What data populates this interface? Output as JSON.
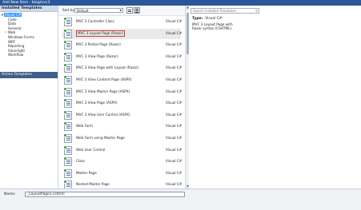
{
  "window": {
    "title": "Add New Item - blogmvc3"
  },
  "left_pane": {
    "installed_header": "Installed Templates",
    "tree": [
      {
        "label": "Visual C#",
        "level": 0,
        "expanded": true,
        "selected": true
      },
      {
        "label": "Code",
        "level": 1
      },
      {
        "label": "Data",
        "level": 1
      },
      {
        "label": "General",
        "level": 1
      },
      {
        "label": "Web",
        "level": 1,
        "collapsed": true
      },
      {
        "label": "Windows Forms",
        "level": 1
      },
      {
        "label": "WPF",
        "level": 1
      },
      {
        "label": "Reporting",
        "level": 1
      },
      {
        "label": "Silverlight",
        "level": 1
      },
      {
        "label": "Workflow",
        "level": 1
      }
    ],
    "online_header": "Online Templates"
  },
  "toolbar": {
    "sort_by_label": "Sort by:",
    "sort_by_value": "Default"
  },
  "templates": [
    {
      "name": "MVC 3 Controller Class",
      "lang": "Visual C#"
    },
    {
      "name": "MVC 3 Layout Page (Razor)",
      "lang": "Visual C#",
      "selected": true
    },
    {
      "name": "MVC 3 Partial Page (Razor)",
      "lang": "Visual C#"
    },
    {
      "name": "MVC 3 View Page (Razor)",
      "lang": "Visual C#"
    },
    {
      "name": "MVC 3 View Page with Layout (Razor)",
      "lang": "Visual C#"
    },
    {
      "name": "MVC 3 View Content Page (ASPX)",
      "lang": "Visual C#"
    },
    {
      "name": "MVC 3 View Master Page (ASPX)",
      "lang": "Visual C#"
    },
    {
      "name": "MVC 3 View Page (ASPX)",
      "lang": "Visual C#"
    },
    {
      "name": "MVC 3 View User Control (ASPX)",
      "lang": "Visual C#"
    },
    {
      "name": "Web Form",
      "lang": "Visual C#"
    },
    {
      "name": "Web Form using Master Page",
      "lang": "Visual C#"
    },
    {
      "name": "Web User Control",
      "lang": "Visual C#"
    },
    {
      "name": "Class",
      "lang": "Visual C#"
    },
    {
      "name": "Master Page",
      "lang": "Visual C#"
    },
    {
      "name": "Nested Master Page",
      "lang": "Visual C#"
    }
  ],
  "right_pane": {
    "search_placeholder": "Search Installed Templates",
    "type_label": "Type:",
    "type_value": "Visual C#",
    "description": "MVC 3 Layout Page with Razor syntax (CSHTML)"
  },
  "bottom": {
    "name_label": "Name:",
    "name_value": "_LayoutPage1.cshtml"
  },
  "colors": {
    "accent": "#3399ff",
    "header_bg": "#cddbed",
    "online_bg": "#3e5f8a",
    "selection_outline": "#d43b3b"
  },
  "icons": {
    "template": "file-icon",
    "search": "magnifier-icon",
    "expand": "triangle-icon",
    "scroll_up": "arrow-up-icon",
    "scroll_down": "arrow-down-icon"
  }
}
